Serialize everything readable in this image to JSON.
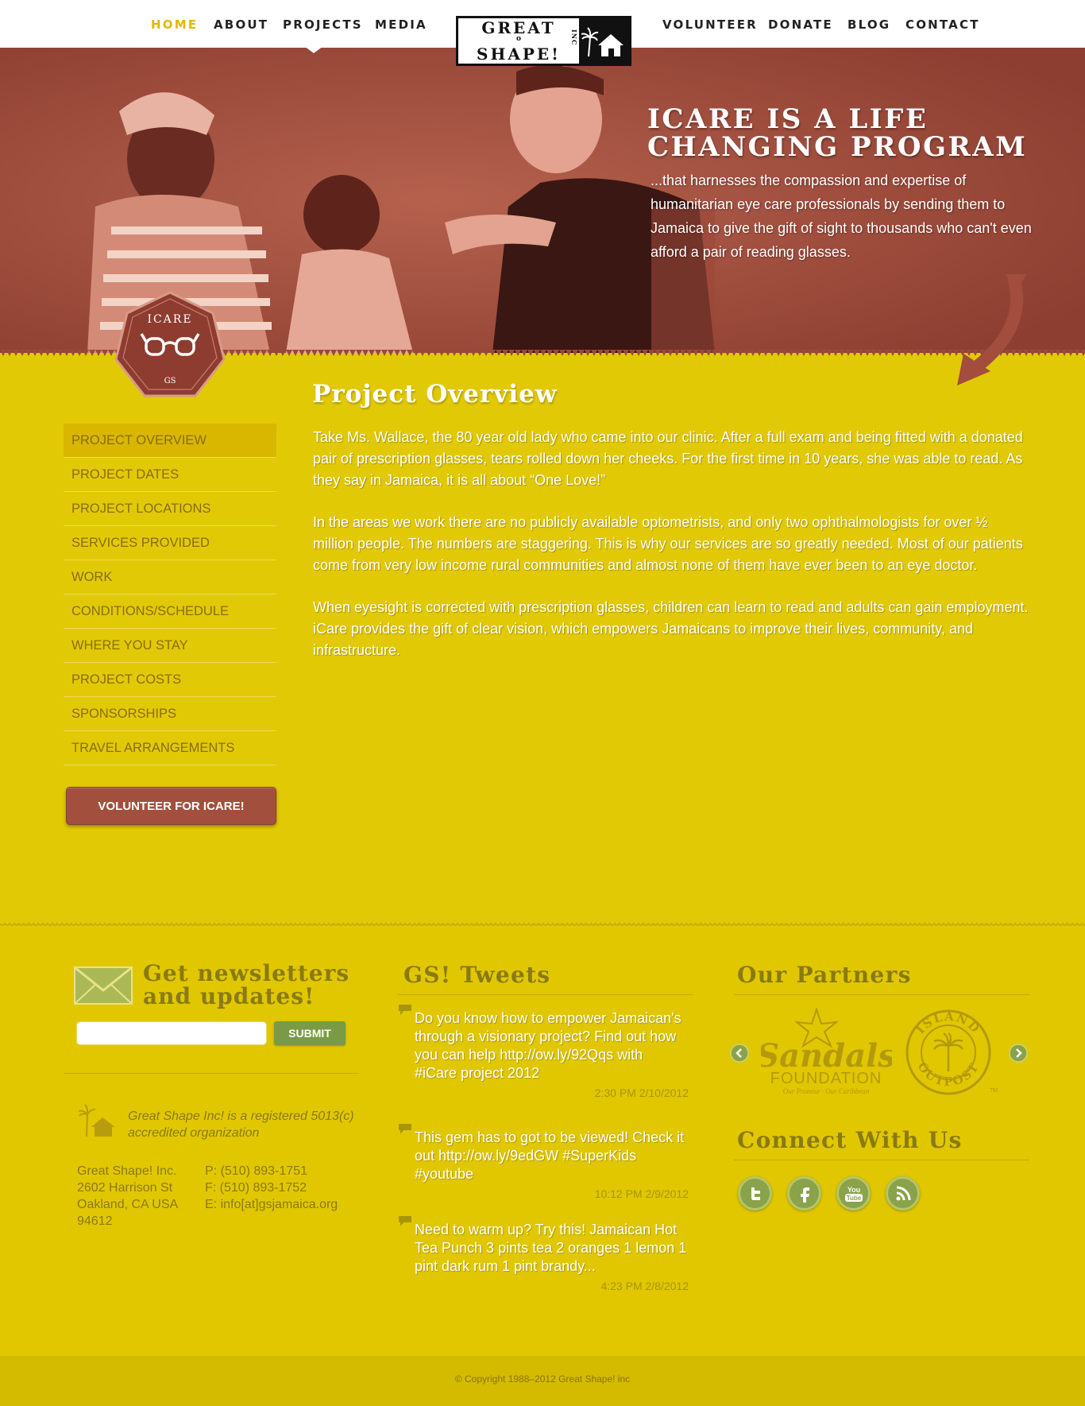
{
  "nav": {
    "left": [
      {
        "label": "HOME",
        "active": true
      },
      {
        "label": "ABOUT"
      },
      {
        "label": "PROJECTS"
      },
      {
        "label": "MEDIA"
      }
    ],
    "right": [
      {
        "label": "VOLUNTEER"
      },
      {
        "label": "DONATE"
      },
      {
        "label": "BLOG"
      },
      {
        "label": "CONTACT"
      }
    ]
  },
  "logo": {
    "line1": "GREAT",
    "line2": "SHAPE!",
    "inc": "INC",
    "sep": "o"
  },
  "hero": {
    "title": "ICARE IS A LIFE CHANGING PROGRAM",
    "subtitle": "...that harnesses the compassion and expertise of humanitarian eye care professionals by sending them to Jamaica to give the gift of sight to thousands who can't even afford a pair of reading glasses."
  },
  "badge": {
    "label": "ICARE",
    "mark": "GS"
  },
  "sidebar": {
    "items": [
      "PROJECT OVERVIEW",
      "PROJECT DATES",
      "PROJECT LOCATIONS",
      "SERVICES PROVIDED",
      "WORK",
      "CONDITIONS/SCHEDULE",
      "WHERE YOU STAY",
      "PROJECT COSTS",
      "SPONSORSHIPS",
      "TRAVEL ARRANGEMENTS"
    ],
    "active_index": 0,
    "volunteer_button": "VOLUNTEER FOR ICARE!"
  },
  "main": {
    "title": "Project Overview",
    "paragraphs": [
      "Take Ms. Wallace, the 80 year old lady who came into our clinic.  After a full exam and being fitted with a donated pair of prescription glasses, tears rolled down her cheeks. For the first time in 10 years, she was able to read. As they say in Jamaica, it is all about “One Love!”",
      "In the areas we work there are no publicly available optometrists, and only two ophthalmologists for over ½ million people.  The numbers are staggering.  This is why our services are so greatly needed. Most of our patients come from very low income rural communities and almost none of them have ever been to an eye doctor.",
      "When eyesight is corrected with prescription glasses, children can learn to read and adults can gain employment. iCare provides the gift of clear vision, which empowers Jamaicans  to improve their lives, community, and infrastructure."
    ]
  },
  "footer": {
    "newsletter": {
      "title": "Get newsletters and updates!",
      "input_placeholder": "",
      "submit_label": "SUBMIT"
    },
    "registration": "Great Shape Inc! is a registered 5013(c) accredited organization",
    "address": [
      "Great Shape! Inc.",
      "2602 Harrison St",
      "Oakland, CA USA",
      "94612"
    ],
    "contact": [
      "P: (510) 893-1751",
      "F: (510) 893-1752",
      "E: info[at]gsjamaica.org"
    ],
    "tweets_title": "GS! Tweets",
    "tweets": [
      {
        "text": "Do you know how to empower Jamaican's through a visionary project? Find out how you can help http://ow.ly/92Qqs with #iCare project 2012",
        "time": "2:30 PM 2/10/2012"
      },
      {
        "text": "This gem has to got to be viewed! Check it out http://ow.ly/9edGW #SuperKids #youtube",
        "time": "10:12 PM 2/9/2012"
      },
      {
        "text": "Need to warm up? Try this! Jamaican Hot Tea Punch 3 pints tea 2 oranges 1 lemon 1 pint dark rum 1 pint brandy...",
        "time": "4:23 PM 2/8/2012"
      }
    ],
    "partners_title": "Our Partners",
    "partners": {
      "sandals": {
        "name": "Sandals",
        "line2": "FOUNDATION",
        "tagline": "Our Promise · Our Caribbean"
      },
      "island": {
        "top": "ISLAND",
        "bottom": "OUTPOST",
        "tm": "TM"
      }
    },
    "connect_title": "Connect With Us",
    "social": [
      "twitter-icon",
      "facebook-icon",
      "youtube-icon",
      "rss-icon"
    ],
    "copyright": "© Copyright 1988–2012 Great Shape! inc"
  },
  "colors": {
    "accent_yellow": "#e2c905",
    "hero_red": "#9c4838",
    "olive_text": "#8a7a12",
    "button_green": "#7a9a46"
  }
}
